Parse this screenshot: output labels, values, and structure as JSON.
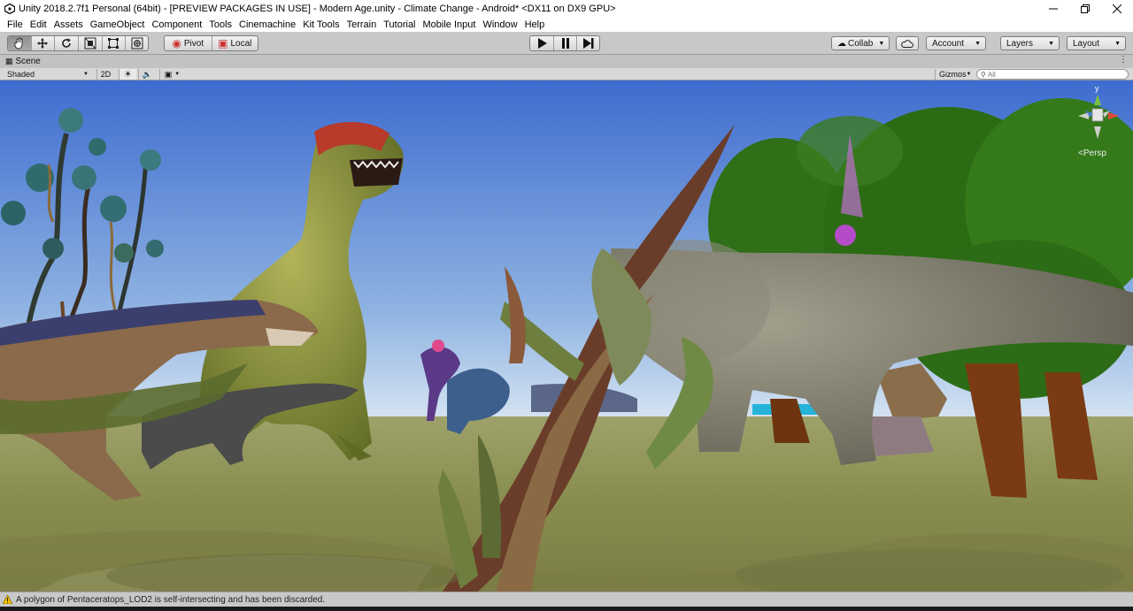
{
  "window": {
    "title": "Unity 2018.2.7f1 Personal (64bit) - [PREVIEW PACKAGES IN USE] - Modern Age.unity - Climate Change - Android* <DX11 on DX9 GPU>",
    "controls": [
      "minimize-icon",
      "maximize-icon",
      "close-icon"
    ]
  },
  "menu": [
    "File",
    "Edit",
    "Assets",
    "GameObject",
    "Component",
    "Tools",
    "Cinemachine",
    "Kit Tools",
    "Terrain",
    "Tutorial",
    "Mobile Input",
    "Window",
    "Help"
  ],
  "toolbar": {
    "transform_tools": [
      "hand-icon",
      "move-icon",
      "rotate-icon",
      "scale-icon",
      "rect-icon",
      "transform-icon"
    ],
    "pivot_label": "Pivot",
    "local_label": "Local",
    "playback": [
      "play-icon",
      "pause-icon",
      "step-icon"
    ],
    "collab_label": "Collab",
    "account_label": "Account",
    "layers_label": "Layers",
    "layout_label": "Layout"
  },
  "scene": {
    "tab_label": "Scene",
    "shading_mode": "Shaded",
    "mode_2d_label": "2D",
    "gizmos_label": "Gizmos",
    "search_placeholder": "All",
    "projection_label": "Persp",
    "gizmo_axis_label": "y"
  },
  "status": {
    "message": "A polygon of Pentaceratops_LOD2 is self-intersecting and has been discarded."
  },
  "colors": {
    "sky_top": "#3f6fd0",
    "sky_horizon": "#d7e6f3",
    "ground": "#8a8f52",
    "warning": "#f2c200"
  }
}
